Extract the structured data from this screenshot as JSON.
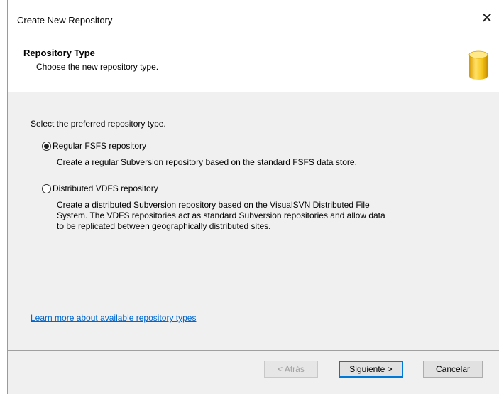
{
  "window": {
    "title": "Create New Repository",
    "close_glyph": "✕"
  },
  "header": {
    "title": "Repository Type",
    "subtitle": "Choose the new repository type.",
    "icon": "database-cylinder-icon",
    "icon_color": "#f2c20e"
  },
  "content": {
    "prompt": "Select the preferred repository type.",
    "options": [
      {
        "label": "Regular FSFS repository",
        "selected": true,
        "description": "Create a regular Subversion repository based on the standard FSFS data store."
      },
      {
        "label": "Distributed VDFS repository",
        "selected": false,
        "description_lines": [
          "Create a distributed Subversion repository based on the VisualSVN Distributed File",
          "System. The VDFS repositories act as standard Subversion repositories and allow data",
          "to be replicated between geographically distributed sites."
        ]
      }
    ],
    "learn_more_link": "Learn more about available repository types"
  },
  "footer": {
    "back_label": "< Atrás",
    "next_label": "Siguiente >",
    "cancel_label": "Cancelar"
  },
  "colors": {
    "link": "#0066cc",
    "content_bg": "#f0f0f0",
    "default_button_border": "#0078d7"
  }
}
